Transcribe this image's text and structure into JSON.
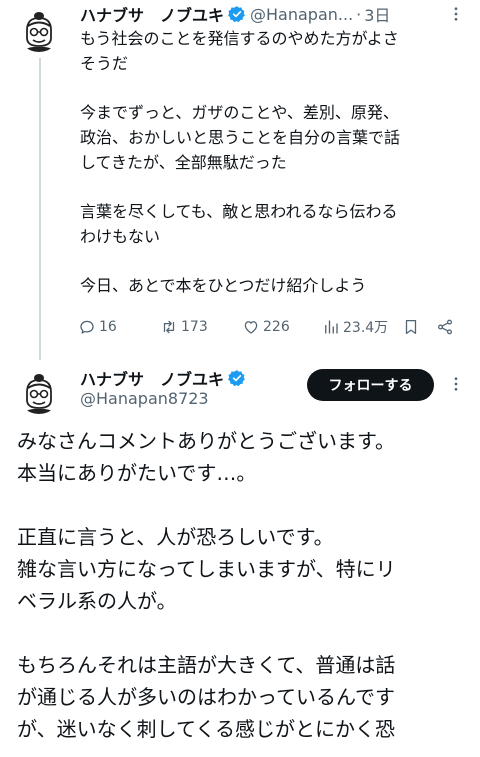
{
  "reply_tweet": {
    "author_name": "ハナブサ　ノブユキ",
    "handle": "@Hanapan...",
    "separator": "·",
    "time": "3日",
    "paragraphs": [
      "もう社会のことを発信するのやめた方がよさ\nそうだ",
      "今までずっと、ガザのことや、差別、原発、\n政治、おかしいと思うことを自分の言葉で話\nしてきたが、全部無駄だった",
      "言葉を尽くしても、敵と思われるなら伝わる\nわけもない",
      "今日、あとで本をひとつだけ紹介しよう"
    ],
    "stats": {
      "replies": "16",
      "retweets": "173",
      "likes": "226",
      "views": "23.4万"
    }
  },
  "main_tweet": {
    "author_name": "ハナブサ　ノブユキ",
    "handle": "@Hanapan8723",
    "follow_label": "フォローする",
    "paragraphs": [
      "みなさんコメントありがとうございます。\n本当にありがたいです…。",
      "正直に言うと、人が恐ろしいです。\n雑な言い方になってしまいますが、特にリ\nベラル系の人が。",
      "もちろんそれは主語が大きくて、普通は話\nが通じる人が多いのはわかっているんです\nが、迷いなく刺してくる感じがとにかく恐"
    ]
  },
  "colors": {
    "text_primary": "#0f1419",
    "text_secondary": "#536471",
    "verified_blue": "#1d9bf0",
    "follow_bg": "#0f1419",
    "thread_line": "#cfd9de"
  },
  "icons": {
    "reply": "speech-bubble-icon",
    "retweet": "retweet-icon",
    "like": "heart-icon",
    "views": "bar-chart-icon",
    "bookmark": "bookmark-icon",
    "share": "share-icon",
    "more": "more-dots-icon",
    "verified": "verified-badge-icon"
  }
}
